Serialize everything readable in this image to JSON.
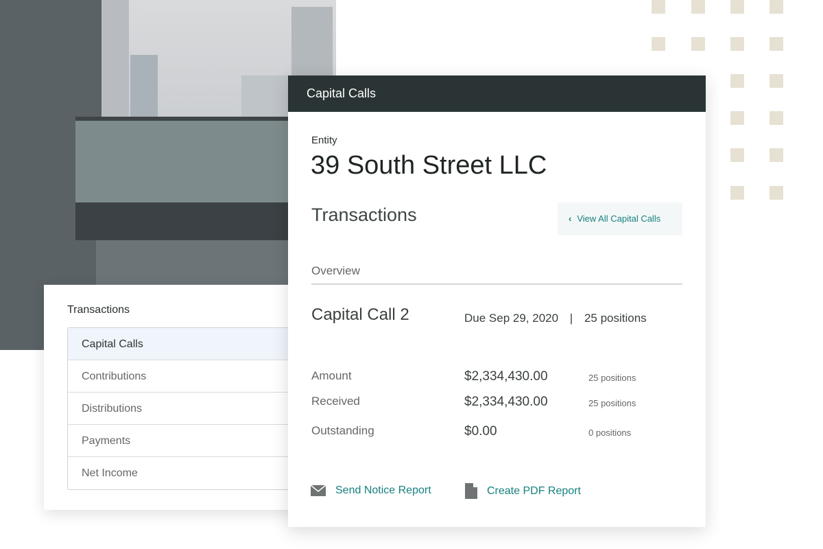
{
  "sidebar": {
    "title": "Transactions",
    "items": [
      {
        "label": "Capital Calls",
        "active": true
      },
      {
        "label": "Contributions"
      },
      {
        "label": "Distributions"
      },
      {
        "label": "Payments"
      },
      {
        "label": "Net Income"
      }
    ]
  },
  "card": {
    "header": "Capital Calls",
    "entity_label": "Entity",
    "entity_name": "39 South Street LLC",
    "section_title": "Transactions",
    "view_all": "View All Capital Calls",
    "tab": "Overview",
    "call_title": "Capital Call 2",
    "due": "Due Sep 29, 2020",
    "separator": "|",
    "positions": "25 positions",
    "rows": [
      {
        "label": "Amount",
        "value": "$2,334,430.00",
        "positions": "25 positions"
      },
      {
        "label": "Received",
        "value": "$2,334,430.00",
        "positions": "25 positions"
      },
      {
        "label": "Outstanding",
        "value": "$0.00",
        "positions": "0 positions"
      }
    ],
    "actions": {
      "send": "Send Notice Report",
      "pdf": "Create PDF Report"
    }
  },
  "colors": {
    "header": "#2a3434",
    "accent": "#17807f",
    "dots": "#e6e1d3"
  }
}
